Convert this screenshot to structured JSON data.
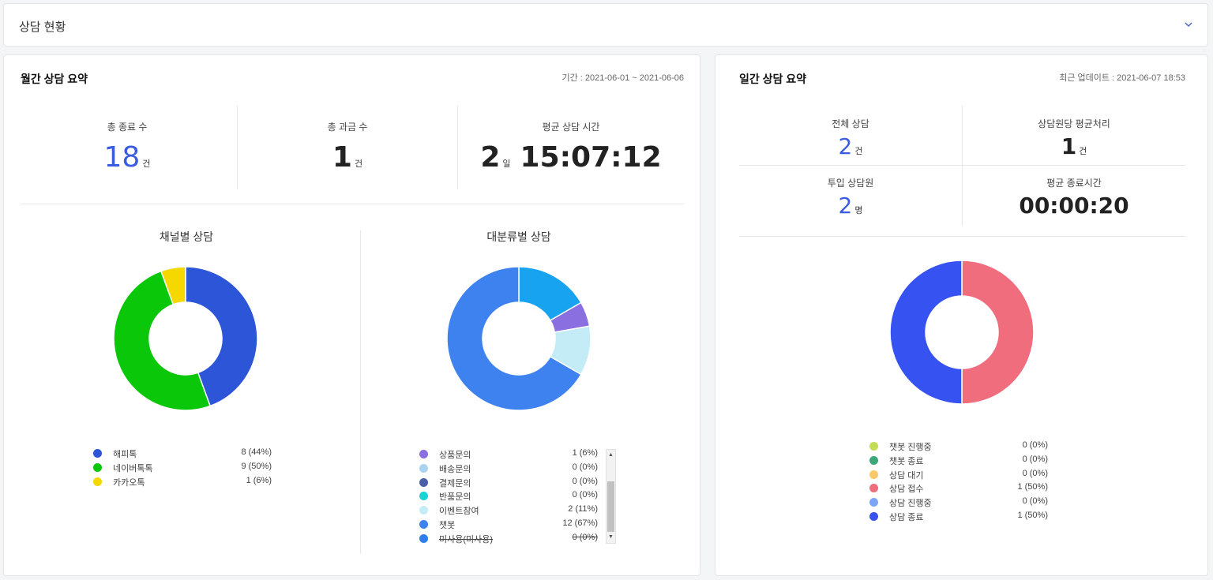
{
  "header": {
    "title": "상담 현황"
  },
  "monthly": {
    "title": "월간 상담 요약",
    "period": "기간 : 2021-06-01 ~ 2021-06-06",
    "stats": {
      "total_closed_label": "총 종료 수",
      "total_closed_value": "18",
      "total_closed_unit": "건",
      "total_billed_label": "총 과금 수",
      "total_billed_value": "1",
      "total_billed_unit": "건",
      "avg_time_label": "평균 상담 시간",
      "avg_time_days": "2",
      "avg_time_days_unit": "일",
      "avg_time_clock": "15:07:12"
    },
    "channel_chart_title": "채널별 상담",
    "category_chart_title": "대분류별 상담"
  },
  "daily": {
    "title": "일간 상담 요약",
    "updated": "최근 업데이트 : 2021-06-07 18:53",
    "stats": {
      "all_label": "전체 상담",
      "all_value": "2",
      "all_unit": "건",
      "avg_per_agent_label": "상담원당 평균처리",
      "avg_per_agent_value": "1",
      "avg_per_agent_unit": "건",
      "agents_label": "투입 상담원",
      "agents_value": "2",
      "agents_unit": "명",
      "avg_close_label": "평균 종료시간",
      "avg_close_value": "00:00:20"
    }
  },
  "chart_data": [
    {
      "type": "pie",
      "title": "채널별 상담",
      "categories": [
        "해피톡",
        "네이버톡톡",
        "카카오톡"
      ],
      "values": [
        8,
        9,
        1
      ],
      "labels": [
        "8 (44%)",
        "9 (50%)",
        "1 (6%)"
      ],
      "colors": [
        "#2c55d8",
        "#0ac70a",
        "#f5d800"
      ]
    },
    {
      "type": "pie",
      "title": "대분류별 상담",
      "categories": [
        "상품문의",
        "배송문의",
        "결제문의",
        "반품문의",
        "이벤트참여",
        "챗봇",
        "미사용(미사용)"
      ],
      "values": [
        1,
        0,
        0,
        0,
        2,
        12,
        0
      ],
      "labels": [
        "1 (6%)",
        "0 (0%)",
        "0 (0%)",
        "0 (0%)",
        "2 (11%)",
        "12 (67%)",
        "0 (0%)"
      ],
      "colors": [
        "#8a6fe0",
        "#a9d3ee",
        "#4a5fa8",
        "#17d4d4",
        "#c4ecf7",
        "#3e82f0",
        "#2d7ee6"
      ],
      "struck": [
        false,
        false,
        false,
        false,
        false,
        false,
        true
      ],
      "extra_slice_color": "#17a3f0"
    },
    {
      "type": "pie",
      "title": "",
      "categories": [
        "챗봇 진행중",
        "챗봇 종료",
        "상담 대기",
        "상담 접수",
        "상담 진행중",
        "상담 종료"
      ],
      "values": [
        0,
        0,
        0,
        1,
        0,
        1
      ],
      "labels": [
        "0 (0%)",
        "0 (0%)",
        "0 (0%)",
        "1 (50%)",
        "0 (0%)",
        "1 (50%)"
      ],
      "colors": [
        "#c3dd57",
        "#3aa877",
        "#fcc96a",
        "#f06d7e",
        "#7aa6f5",
        "#3653f2"
      ]
    }
  ]
}
